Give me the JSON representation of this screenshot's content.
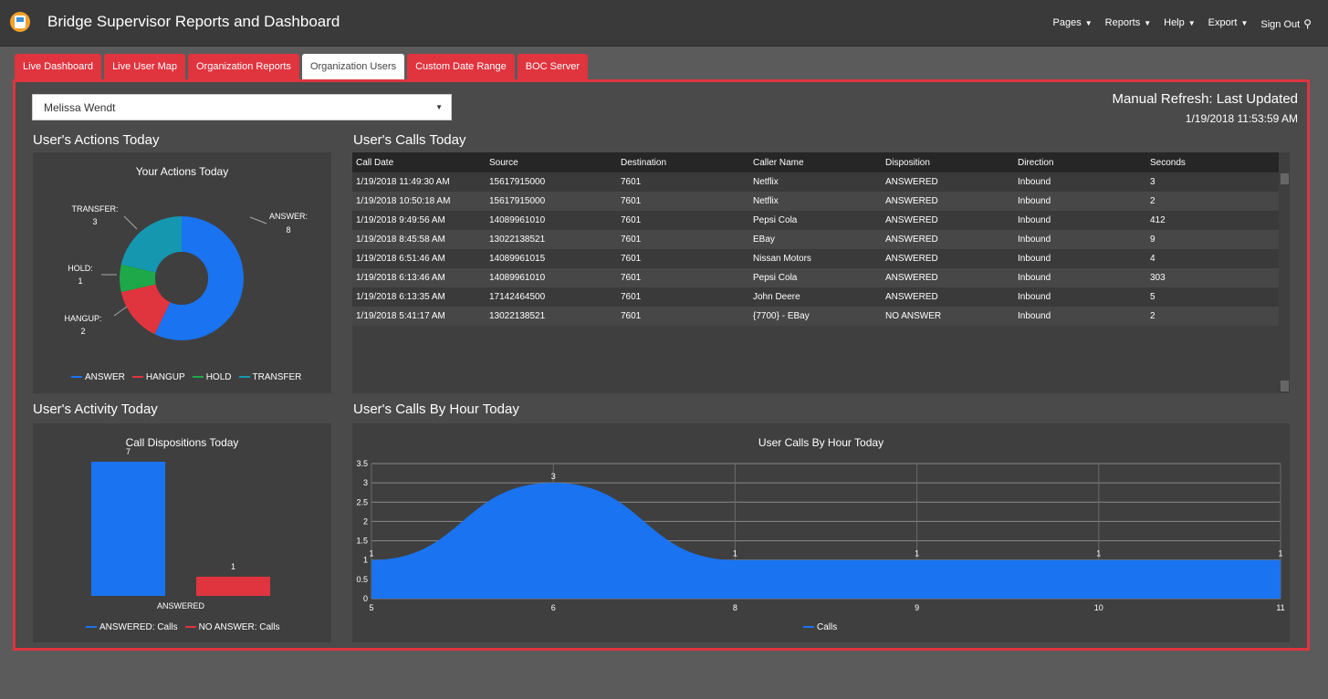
{
  "app": {
    "title": "Bridge Supervisor Reports and Dashboard"
  },
  "nav": [
    {
      "label": "Pages"
    },
    {
      "label": "Reports"
    },
    {
      "label": "Help"
    },
    {
      "label": "Export"
    }
  ],
  "signout": {
    "label": "Sign Out",
    "icon": "user-logout-icon"
  },
  "tabs": [
    {
      "label": "Live Dashboard",
      "active": false
    },
    {
      "label": "Live User Map",
      "active": false
    },
    {
      "label": "Organization Reports",
      "active": false
    },
    {
      "label": "Organization Users",
      "active": true
    },
    {
      "label": "Custom Date Range",
      "active": false
    },
    {
      "label": "BOC Server",
      "active": false
    }
  ],
  "user_select": {
    "value": "Melissa Wendt"
  },
  "refresh": {
    "title": "Manual Refresh: Last Updated",
    "time": "1/19/2018 11:53:59 AM"
  },
  "sections": {
    "actions": "User's Actions Today",
    "calls": "User's Calls Today",
    "activity": "User's Activity Today",
    "by_hour": "User's Calls By Hour Today"
  },
  "calls_table": {
    "headers": [
      "Call Date",
      "Source",
      "Destination",
      "Caller Name",
      "Disposition",
      "Direction",
      "Seconds"
    ],
    "rows": [
      [
        "1/19/2018 11:49:30 AM",
        "15617915000",
        "7601",
        "Netflix",
        "ANSWERED",
        "Inbound",
        "3"
      ],
      [
        "1/19/2018 10:50:18 AM",
        "15617915000",
        "7601",
        "Netflix",
        "ANSWERED",
        "Inbound",
        "2"
      ],
      [
        "1/19/2018 9:49:56 AM",
        "14089961010",
        "7601",
        "Pepsi Cola",
        "ANSWERED",
        "Inbound",
        "412"
      ],
      [
        "1/19/2018 8:45:58 AM",
        "13022138521",
        "7601",
        "EBay",
        "ANSWERED",
        "Inbound",
        "9"
      ],
      [
        "1/19/2018 6:51:46 AM",
        "14089961015",
        "7601",
        "Nissan Motors",
        "ANSWERED",
        "Inbound",
        "4"
      ],
      [
        "1/19/2018 6:13:46 AM",
        "14089961010",
        "7601",
        "Pepsi Cola",
        "ANSWERED",
        "Inbound",
        "303"
      ],
      [
        "1/19/2018 6:13:35 AM",
        "17142464500",
        "7601",
        "John Deere",
        "ANSWERED",
        "Inbound",
        "5"
      ],
      [
        "1/19/2018 5:41:17 AM",
        "13022138521",
        "7601",
        "{7700} - EBay",
        "NO ANSWER",
        "Inbound",
        "2"
      ]
    ]
  },
  "colors": {
    "answer": "#1a73f0",
    "hangup": "#e0343f",
    "hold": "#1ea84a",
    "transfer": "#1597b0",
    "accent": "#e0343f"
  },
  "chart_data": [
    {
      "type": "pie",
      "title": "Your Actions Today",
      "labels": [
        "ANSWER",
        "HANGUP",
        "HOLD",
        "TRANSFER"
      ],
      "values": [
        8,
        2,
        1,
        3
      ],
      "slice_labels": [
        "ANSWER:",
        "HANGUP:",
        "HOLD:",
        "TRANSFER:"
      ],
      "donut": true,
      "legend": "bottom"
    },
    {
      "type": "bar",
      "title": "Call Dispositions Today",
      "categories": [
        "ANSWERED"
      ],
      "series": [
        {
          "name": "ANSWERED: Calls",
          "values": [
            7
          ]
        },
        {
          "name": "NO ANSWER: Calls",
          "values": [
            1
          ]
        }
      ],
      "legend": "bottom"
    },
    {
      "type": "area",
      "title": "User Calls By Hour Today",
      "x": [
        5,
        6,
        8,
        9,
        10,
        11
      ],
      "series": [
        {
          "name": "Calls",
          "values": [
            1,
            3,
            1,
            1,
            1,
            1
          ]
        }
      ],
      "yticks": [
        "0",
        "0.5",
        "1",
        "1.5",
        "2",
        "2.5",
        "3",
        "3.5"
      ],
      "ylim": [
        0,
        3.5
      ],
      "grid": true,
      "legend": "bottom"
    }
  ]
}
